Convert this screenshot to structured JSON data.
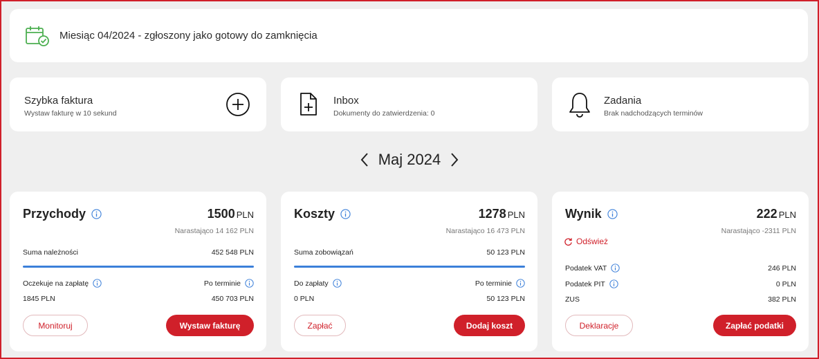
{
  "banner": {
    "text": "Miesiąc 04/2024 - zgłoszony jako gotowy do zamknięcia",
    "icon": "calendar-check-icon"
  },
  "quick_actions": [
    {
      "title": "Szybka faktura",
      "subtitle": "Wystaw fakturę w 10 sekund",
      "icon": "plus-circle-icon"
    },
    {
      "title": "Inbox",
      "subtitle": "Dokumenty do zatwierdzenia: 0",
      "icon": "document-plus-icon"
    },
    {
      "title": "Zadania",
      "subtitle": "Brak nadchodzących terminów",
      "icon": "bell-icon"
    }
  ],
  "month_nav": {
    "label": "Maj 2024"
  },
  "colors": {
    "accent": "#d0202a",
    "bar": "#3b7fd9",
    "banner_icon": "#4caf50"
  },
  "income": {
    "title": "Przychody",
    "amount": "1500",
    "currency": "PLN",
    "cumulative": "Narastająco 14 162 PLN",
    "sum_label": "Suma należności",
    "sum_value": "452 548 PLN",
    "left_label": "Oczekuje na zapłatę",
    "left_value": "1845 PLN",
    "right_label": "Po terminie",
    "right_value": "450 703 PLN",
    "btn_outline": "Monitoruj",
    "btn_solid": "Wystaw fakturę"
  },
  "costs": {
    "title": "Koszty",
    "amount": "1278",
    "currency": "PLN",
    "cumulative": "Narastająco 16 473 PLN",
    "sum_label": "Suma zobowiązań",
    "sum_value": "50 123 PLN",
    "left_label": "Do zapłaty",
    "left_value": "0 PLN",
    "right_label": "Po terminie",
    "right_value": "50 123 PLN",
    "btn_outline": "Zapłać",
    "btn_solid": "Dodaj koszt"
  },
  "result": {
    "title": "Wynik",
    "amount": "222",
    "currency": "PLN",
    "cumulative": "Narastająco -2311 PLN",
    "refresh": "Odśwież",
    "vat_label": "Podatek VAT",
    "vat_value": "246 PLN",
    "pit_label": "Podatek PIT",
    "pit_value": "0 PLN",
    "zus_label": "ZUS",
    "zus_value": "382 PLN",
    "btn_outline": "Deklaracje",
    "btn_solid": "Zapłać podatki"
  }
}
